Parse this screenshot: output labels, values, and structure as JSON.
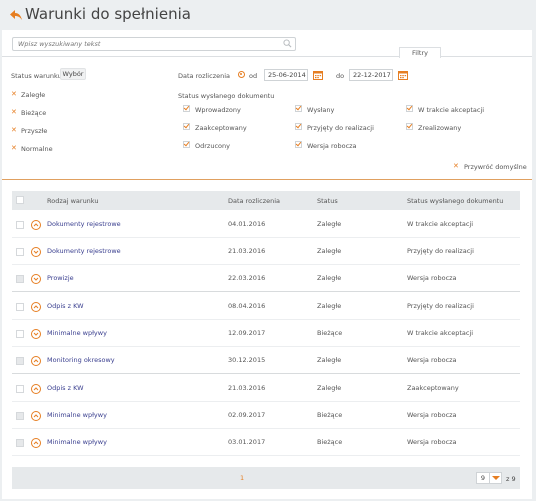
{
  "header": {
    "title": "Warunki do spełnienia"
  },
  "search": {
    "placeholder": "Wpisz wyszukiwany tekst"
  },
  "filters": {
    "tab_label": "Filtry",
    "status_label": "Status warunku",
    "choose_label": "Wybór",
    "status_options": [
      "Zaległe",
      "Bieżące",
      "Przyszłe",
      "Normalne"
    ],
    "date_label": "Data rozliczenia",
    "from_label": "od",
    "from_value": "25-06-2014",
    "to_label": "do",
    "to_value": "22-12-2017",
    "doc_status_label": "Status wysłanego dokumentu",
    "doc_status_options": [
      [
        "Wprowadzony",
        "Wysłany",
        "W trakcie akceptacji"
      ],
      [
        "Zaakceptowany",
        "Przyjęty do realizacji",
        "Zrealizowany"
      ],
      [
        "Odrzucony",
        "Wersja robocza",
        ""
      ]
    ],
    "reset_label": "Przywróć domyślne"
  },
  "table": {
    "headers": [
      "Rodzaj warunku",
      "Data rozliczenia",
      "Status",
      "Status wysłanego dokumentu"
    ],
    "rows": [
      [
        "Dokumenty rejestrowe",
        "04.01.2016",
        "Zaległe",
        "W trakcie akceptacji"
      ],
      [
        "Dokumenty rejestrowe",
        "21.03.2016",
        "Zaległe",
        "Przyjęty do realizacji"
      ],
      [
        "Prowizje",
        "22.03.2016",
        "Zaległe",
        "Wersja robocza"
      ],
      [
        "Odpis z KW",
        "08.04.2016",
        "Zaległe",
        "Przyjęty do realizacji"
      ],
      [
        "Minimalne wpływy",
        "12.09.2017",
        "Bieżące",
        "W trakcie akceptacji"
      ],
      [
        "Monitoring okresowy",
        "30.12.2015",
        "Zaległe",
        "Wersja robocza"
      ],
      [
        "Odpis z KW",
        "21.03.2016",
        "Zaległe",
        "Zaakceptowany"
      ],
      [
        "Minimalne wpływy",
        "02.09.2017",
        "Bieżące",
        "Wersja robocza"
      ],
      [
        "Minimalne wpływy",
        "03.01.2017",
        "Bieżące",
        "Wersja robocza"
      ]
    ]
  },
  "pagination": {
    "current": "1",
    "select_value": "9",
    "of_label": "z 9"
  },
  "colors": {
    "accent": "#e67e22",
    "link": "#3a3f8f"
  }
}
